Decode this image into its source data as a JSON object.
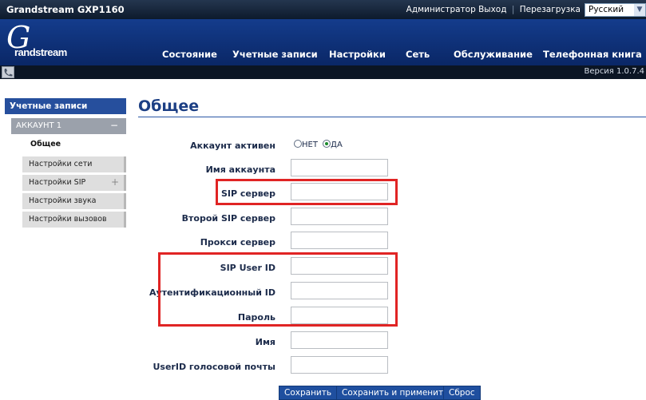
{
  "topbar": {
    "model": "Grandstream GXP1160",
    "user_label": "Администратор",
    "logout": "Выход",
    "reboot": "Перезагрузка",
    "language": "Русский"
  },
  "logo": {
    "brand": "Grandstream"
  },
  "nav": {
    "items": [
      "Состояние",
      "Учетные записи",
      "Настройки",
      "Сеть",
      "Обслуживание",
      "Телефонная книга"
    ]
  },
  "subbar": {
    "version": "Версия 1.0.7.4"
  },
  "sidebar": {
    "section": "Учетные записи",
    "account": "АККАУНТ 1",
    "active_item": "Общее",
    "items": [
      "Настройки сети",
      "Настройки SIP",
      "Настройки звука",
      "Настройки вызовов"
    ]
  },
  "main": {
    "title": "Общее",
    "account_active": {
      "label": "Аккаунт активен",
      "no": "НЕТ",
      "yes": "ДА",
      "selected": "ДА"
    },
    "fields": [
      {
        "label": "Имя аккаунта",
        "value": ""
      },
      {
        "label": "SIP сервер",
        "value": ""
      },
      {
        "label": "Второй SIP сервер",
        "value": ""
      },
      {
        "label": "Прокси сервер",
        "value": ""
      },
      {
        "label": "SIP User ID",
        "value": ""
      },
      {
        "label": "Аутентификационный ID",
        "value": ""
      },
      {
        "label": "Пароль",
        "value": ""
      },
      {
        "label": "Имя",
        "value": ""
      },
      {
        "label": "UserID голосовой почты",
        "value": ""
      }
    ],
    "buttons": {
      "save": "Сохранить",
      "save_apply": "Сохранить и применить",
      "reset": "Сброс"
    }
  },
  "colors": {
    "header": "#143c8c",
    "highlight": "#e02424",
    "button": "#1f4f9f"
  }
}
